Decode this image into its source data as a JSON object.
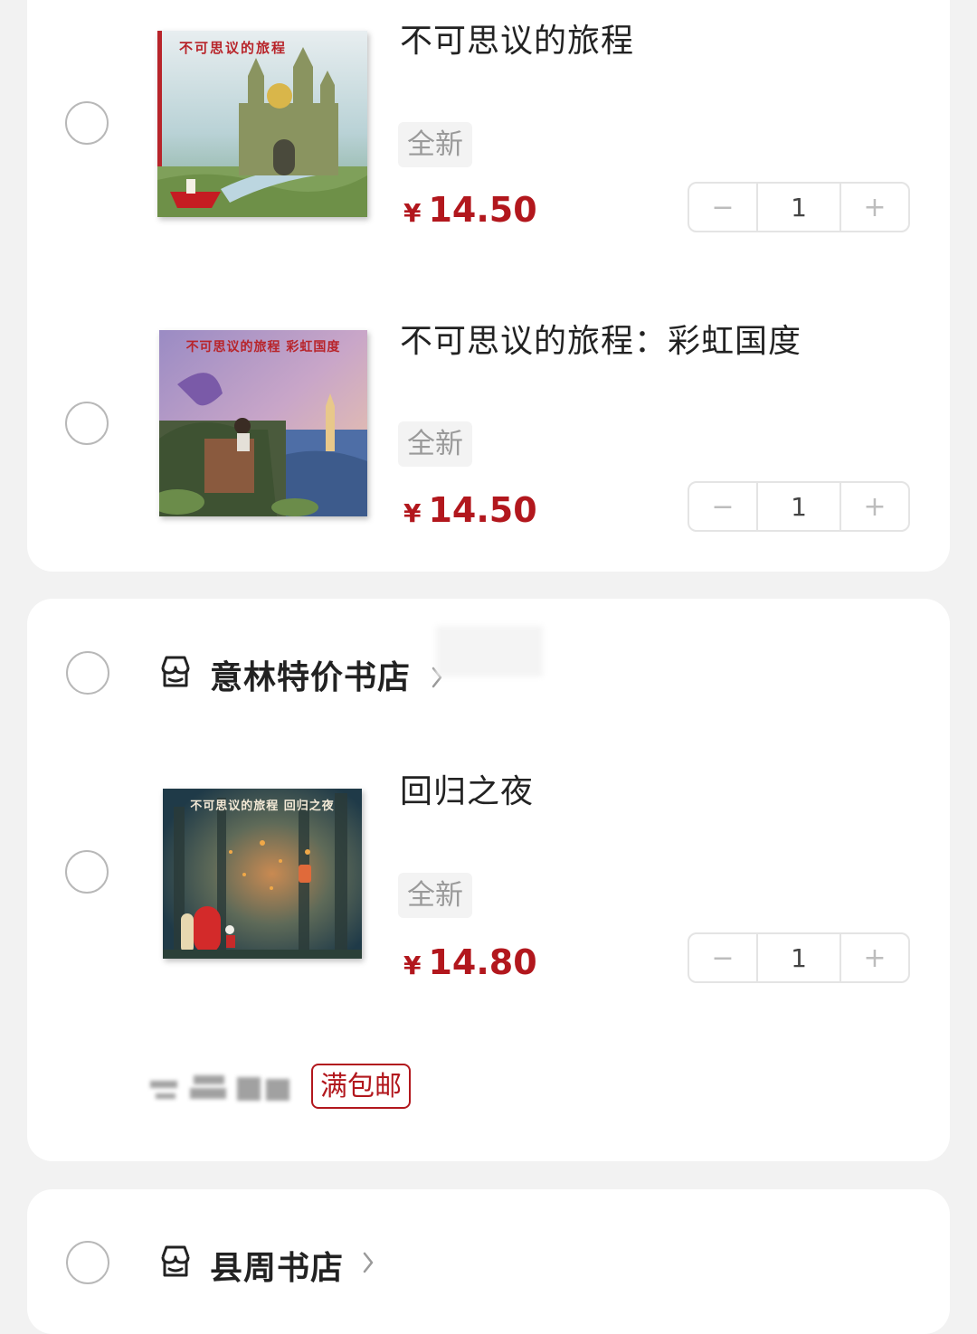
{
  "stores": [
    {
      "items": [
        {
          "cover_title": "不可思议的旅程",
          "title": "不可思议的旅程",
          "condition": "全新",
          "currency": "¥",
          "price": "14.50",
          "quantity": "1"
        },
        {
          "cover_title": "不可思议的旅程 彩虹国度",
          "title": "不可思议的旅程：彩虹国度",
          "condition": "全新",
          "currency": "¥",
          "price": "14.50",
          "quantity": "1"
        }
      ]
    },
    {
      "name": "意林特价书店",
      "items": [
        {
          "cover_title": "不可思议的旅程 回归之夜",
          "title": "回归之夜",
          "condition": "全新",
          "currency": "¥",
          "price": "14.80",
          "quantity": "1"
        }
      ],
      "shipping_badge": "满包邮"
    },
    {
      "name": "县周书店"
    }
  ],
  "stepper": {
    "minus": "−",
    "plus": "+"
  },
  "colors": {
    "price": "#b2171d",
    "background": "#f2f2f2",
    "card": "#ffffff"
  },
  "icons": {
    "store": "store-icon",
    "chevron": "chevron-right-icon",
    "radio": "radio-unchecked-icon"
  }
}
